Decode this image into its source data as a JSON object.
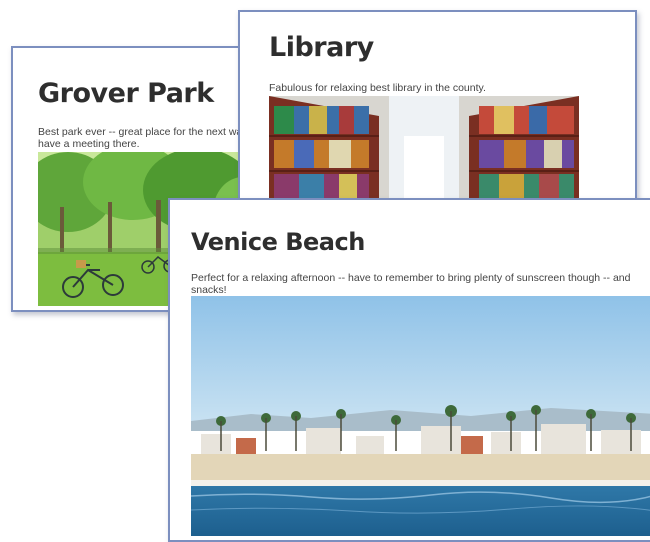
{
  "cards": [
    {
      "title": "Grover Park",
      "description": "Best park ever -- great place for the next wants to have a meeting there."
    },
    {
      "title": "Library",
      "description": "Fabulous for relaxing  best library in the county."
    },
    {
      "title": "Venice Beach",
      "description": "Perfect for a relaxing afternoon -- have to remember to bring plenty of sunscreen though -- and snacks!"
    }
  ],
  "colors": {
    "card_border": "#7c8fbf",
    "title_text": "#2e2e2e",
    "body_text": "#444444"
  }
}
